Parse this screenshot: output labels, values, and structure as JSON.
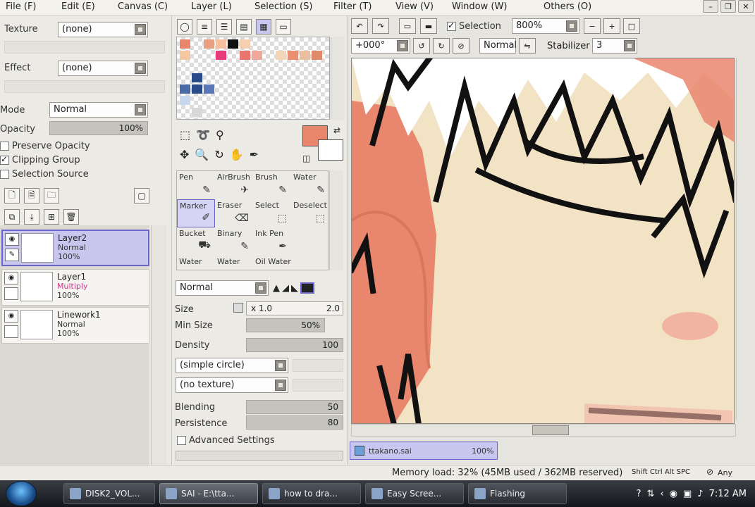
{
  "menu": [
    "File (F)",
    "Edit (E)",
    "Canvas (C)",
    "Layer (L)",
    "Selection (S)",
    "Filter (T)",
    "View (V)",
    "Window (W)",
    "Others (O)"
  ],
  "left": {
    "texture_label": "Texture",
    "texture_value": "(none)",
    "effect_label": "Effect",
    "effect_value": "(none)",
    "mode_label": "Mode",
    "mode_value": "Normal",
    "opacity_label": "Opacity",
    "opacity_value": "100%",
    "preserve_opacity": "Preserve Opacity",
    "clipping_group": "Clipping Group",
    "selection_source": "Selection Source"
  },
  "layers": [
    {
      "name": "Layer2",
      "mode": "Normal",
      "opacity": "100%",
      "selected": true
    },
    {
      "name": "Layer1",
      "mode": "Multiply",
      "opacity": "100%",
      "selected": false
    },
    {
      "name": "Linework1",
      "mode": "Normal",
      "opacity": "100%",
      "selected": false
    }
  ],
  "tools": {
    "row1": [
      "Pen",
      "AirBrush",
      "Brush",
      "Water"
    ],
    "row2": [
      "Marker",
      "Eraser",
      "Select",
      "Deselect"
    ],
    "row3": [
      "Bucket",
      "Binary",
      "Ink Pen",
      ""
    ],
    "row4": [
      "Water",
      "Water",
      "Oil Water",
      ""
    ]
  },
  "brush": {
    "mode": "Normal",
    "size_label": "Size",
    "size_mult": "x 1.0",
    "size_value": "2.0",
    "minsize_label": "Min Size",
    "minsize_value": "50%",
    "density_label": "Density",
    "density_value": "100",
    "shape": "(simple circle)",
    "texture": "(no texture)",
    "blending_label": "Blending",
    "blending_value": "50",
    "persistence_label": "Persistence",
    "persistence_value": "80",
    "advanced": "Advanced Settings"
  },
  "canvas_toolbar": {
    "selection_label": "Selection",
    "zoom_value": "800%",
    "angle_value": "+000°",
    "blend_mode": "Normal",
    "stabilizer_label": "Stabilizer",
    "stabilizer_value": "3"
  },
  "canvas_tab": {
    "name": "ttakano.sai",
    "zoom": "100%"
  },
  "status": {
    "memory": "Memory load: 32% (45MB used / 362MB reserved)",
    "keys": "Shift Ctrl Alt SPC",
    "any": "Any"
  },
  "taskbar": {
    "tasks": [
      "DISK2_VOL...",
      "SAI - E:\\tta...",
      "how to dra...",
      "Easy Scree...",
      "Flashing"
    ],
    "time": "7:12 AM"
  },
  "colors": {
    "primary": "#e8866c",
    "secondary": "#ffffff",
    "accent": "#6a66c8"
  }
}
